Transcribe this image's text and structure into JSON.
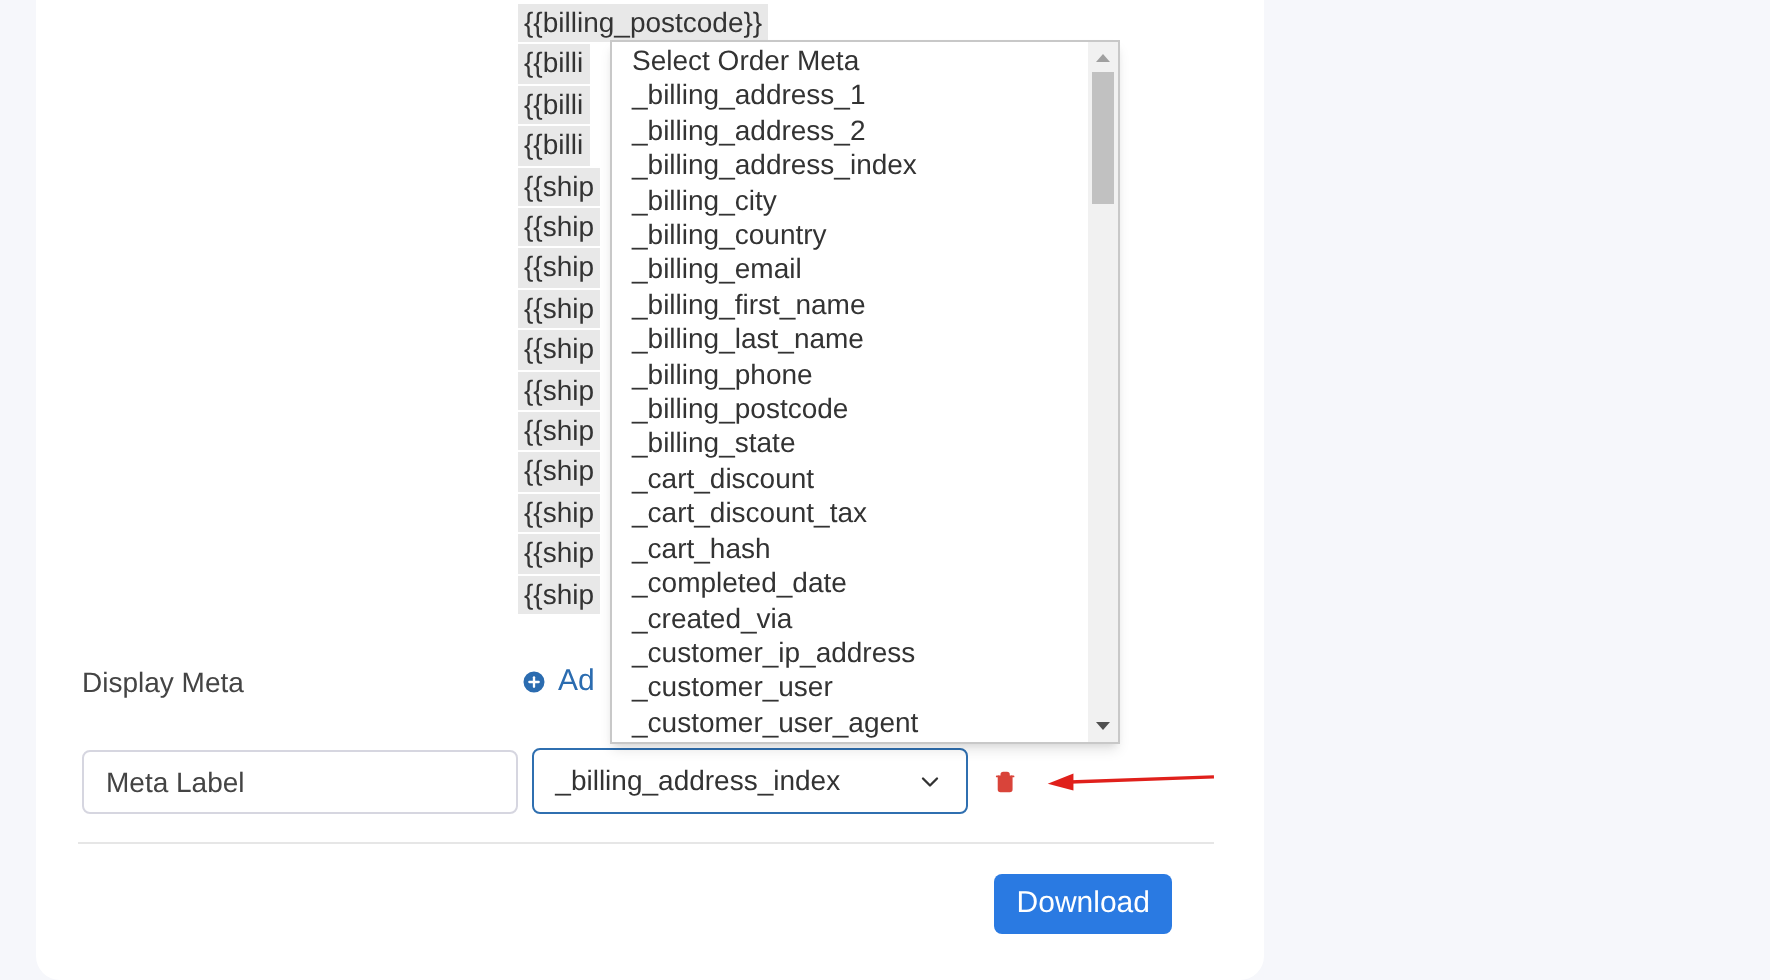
{
  "placeholders": [
    "{{billing_postcode}}",
    "{{billi",
    "{{billi",
    "{{billi",
    "{{ship",
    "{{ship",
    "{{ship",
    "{{ship",
    "{{ship",
    "{{ship",
    "{{ship",
    "{{ship",
    "{{ship",
    "{{ship",
    "{{ship"
  ],
  "display_meta": {
    "label": "Display Meta",
    "add_link": "Ad"
  },
  "meta_row": {
    "label_field": {
      "value": "Meta Label"
    },
    "select": {
      "value": "_billing_address_index"
    }
  },
  "dropdown": {
    "options": [
      "Select Order Meta",
      "_billing_address_1",
      "_billing_address_2",
      "_billing_address_index",
      "_billing_city",
      "_billing_country",
      "_billing_email",
      "_billing_first_name",
      "_billing_last_name",
      "_billing_phone",
      "_billing_postcode",
      "_billing_state",
      "_cart_discount",
      "_cart_discount_tax",
      "_cart_hash",
      "_completed_date",
      "_created_via",
      "_customer_ip_address",
      "_customer_user",
      "_customer_user_agent"
    ]
  },
  "download_button": "Download"
}
